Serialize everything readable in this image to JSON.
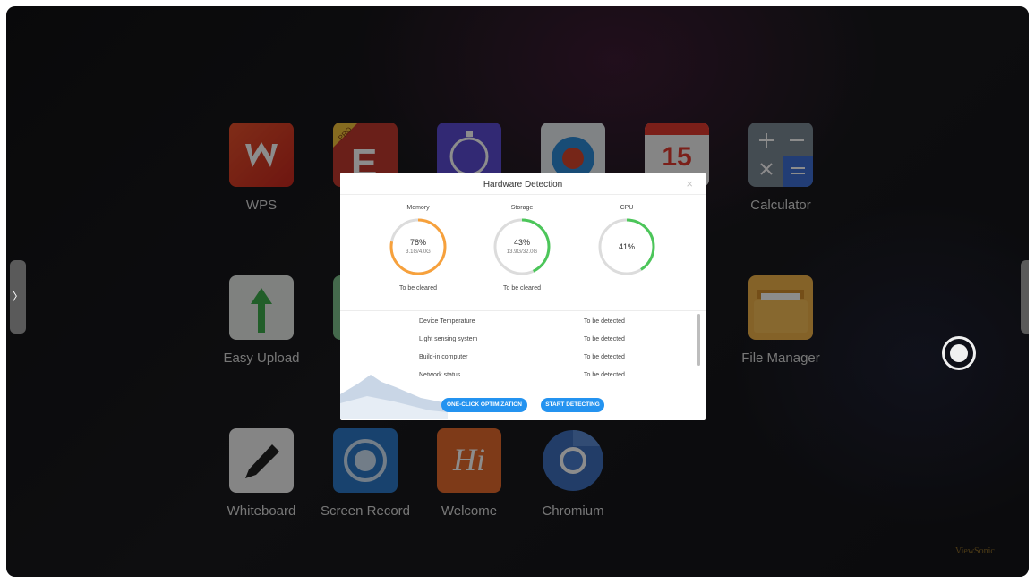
{
  "apps": [
    {
      "label": "WPS",
      "icon": "wps-icon"
    },
    {
      "label": "",
      "icon": "e-pro-icon"
    },
    {
      "label": "",
      "icon": "timer-icon"
    },
    {
      "label": "",
      "icon": "browser-icon"
    },
    {
      "label": "",
      "icon": "calendar-icon",
      "badge": "15"
    },
    {
      "label": "Calculator",
      "icon": "calculator-icon"
    },
    {
      "label": "Easy Upload",
      "icon": "upload-icon"
    },
    {
      "label": "File Manager",
      "icon": "folder-icon"
    },
    {
      "label": "Whiteboard",
      "icon": "pen-icon"
    },
    {
      "label": "Screen Record",
      "icon": "record-icon"
    },
    {
      "label": "Welcome",
      "icon": "hi-icon",
      "glyph": "Hi"
    },
    {
      "label": "Chromium",
      "icon": "chromium-icon"
    }
  ],
  "side_tabs": {
    "left": "〉",
    "right": "〈"
  },
  "brand": "ViewSonic",
  "dialog": {
    "title": "Hardware Detection",
    "close": "×",
    "gauges": [
      {
        "name": "Memory",
        "percent_text": "78%",
        "detail": "3.1G/4.0G",
        "status": "To be cleared",
        "value": 0.78,
        "color": "#f7a13c"
      },
      {
        "name": "Storage",
        "percent_text": "43%",
        "detail": "13.9G/32.0G",
        "status": "To be cleared",
        "value": 0.43,
        "color": "#4cc65a"
      },
      {
        "name": "CPU",
        "percent_text": "41%",
        "detail": "",
        "status": "",
        "value": 0.41,
        "color": "#4cc65a"
      }
    ],
    "rows": [
      {
        "label": "Device Temperature",
        "value": "To be detected"
      },
      {
        "label": "Light sensing system",
        "value": "To be detected"
      },
      {
        "label": "Build-in computer",
        "value": "To be detected"
      },
      {
        "label": "Network status",
        "value": "To be detected"
      }
    ],
    "buttons": {
      "optimize": "ONE-CLICK OPTIMIZATION",
      "detect": "START DETECTING"
    }
  }
}
